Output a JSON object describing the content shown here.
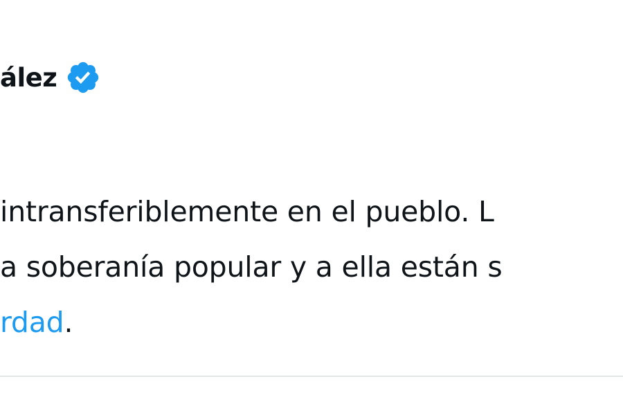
{
  "tweet": {
    "author_name": "ález",
    "verified_icon": "verified-badge-icon",
    "accent_color": "#1d9bf0",
    "text_lines": [
      "intransferiblemente en el pueblo. L",
      "a soberanía popular y a ella están s"
    ],
    "last_line_link": "rdad",
    "last_line_suffix": "."
  }
}
